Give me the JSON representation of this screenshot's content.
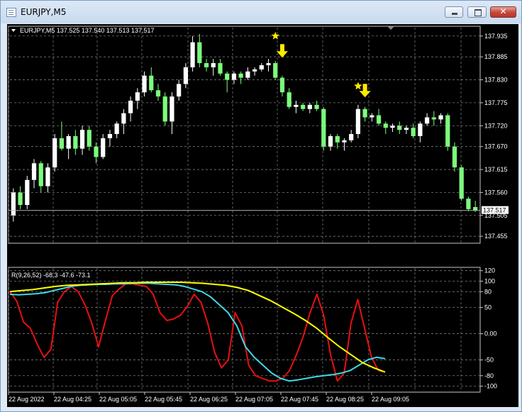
{
  "window": {
    "title": "EURJPY,M5"
  },
  "price_panel": {
    "header": "EURJPY,M5  137.525 137.540 137.513 137.517",
    "current_price_label": "137.517",
    "price_ticks": [
      "137.935",
      "137.885",
      "137.830",
      "137.775",
      "137.720",
      "137.670",
      "137.615",
      "137.560",
      "137.505",
      "137.455"
    ],
    "colors": {
      "bull": "#ffffff",
      "bear": "#7cfc7c",
      "markers": "#ffea00"
    }
  },
  "indicator_panel": {
    "header": "R(9,26,52) -68.3 -47.6 -73.1",
    "ticks": [
      "120",
      "100",
      "80",
      "50",
      "0.00",
      "-50",
      "-80",
      "-100"
    ],
    "colors": {
      "fast": "#e81010",
      "medium": "#3fd9e8",
      "slow": "#ffff00"
    }
  },
  "time_axis": [
    "22 Aug 2022",
    "22 Aug 04:25",
    "22 Aug 05:05",
    "22 Aug 05:45",
    "22 Aug 06:25",
    "22 Aug 07:05",
    "22 Aug 07:45",
    "22 Aug 08:25",
    "22 Aug 09:05"
  ],
  "chart_data": {
    "type": "candlestick",
    "symbol": "EURJPY",
    "timeframe": "M5",
    "last_bar": {
      "open": 137.525,
      "high": 137.54,
      "low": 137.513,
      "close": 137.517
    },
    "ylim": [
      137.44,
      137.955
    ],
    "candles": [
      [
        137.505,
        137.57,
        137.49,
        137.56
      ],
      [
        137.56,
        137.575,
        137.52,
        137.53
      ],
      [
        137.53,
        137.6,
        137.52,
        137.59
      ],
      [
        137.59,
        137.64,
        137.57,
        137.63
      ],
      [
        137.63,
        137.635,
        137.56,
        137.575
      ],
      [
        137.575,
        137.63,
        137.56,
        137.62
      ],
      [
        137.62,
        137.7,
        137.61,
        137.69
      ],
      [
        137.69,
        137.73,
        137.66,
        137.665
      ],
      [
        137.665,
        137.7,
        137.64,
        137.695
      ],
      [
        137.695,
        137.71,
        137.65,
        137.665
      ],
      [
        137.665,
        137.72,
        137.65,
        137.71
      ],
      [
        137.71,
        137.72,
        137.66,
        137.67
      ],
      [
        137.67,
        137.68,
        137.63,
        137.645
      ],
      [
        137.645,
        137.7,
        137.64,
        137.69
      ],
      [
        137.69,
        137.71,
        137.67,
        137.7
      ],
      [
        137.7,
        137.73,
        137.69,
        137.725
      ],
      [
        137.725,
        137.76,
        137.7,
        137.75
      ],
      [
        137.75,
        137.79,
        137.73,
        137.78
      ],
      [
        137.78,
        137.81,
        137.76,
        137.8
      ],
      [
        137.8,
        137.85,
        137.79,
        137.84
      ],
      [
        137.84,
        137.86,
        137.8,
        137.805
      ],
      [
        137.805,
        137.82,
        137.78,
        137.79
      ],
      [
        137.79,
        137.8,
        137.72,
        137.73
      ],
      [
        137.73,
        137.8,
        137.7,
        137.79
      ],
      [
        137.79,
        137.83,
        137.78,
        137.82
      ],
      [
        137.82,
        137.87,
        137.81,
        137.86
      ],
      [
        137.86,
        137.935,
        137.85,
        137.92
      ],
      [
        137.92,
        137.94,
        137.86,
        137.87
      ],
      [
        137.87,
        137.88,
        137.85,
        137.86
      ],
      [
        137.86,
        137.88,
        137.84,
        137.87
      ],
      [
        137.87,
        137.88,
        137.84,
        137.845
      ],
      [
        137.845,
        137.85,
        137.8,
        137.83
      ],
      [
        137.83,
        137.85,
        137.82,
        137.845
      ],
      [
        137.845,
        137.85,
        137.82,
        137.835
      ],
      [
        137.835,
        137.86,
        137.83,
        137.85
      ],
      [
        137.85,
        137.86,
        137.84,
        137.855
      ],
      [
        137.855,
        137.87,
        137.85,
        137.865
      ],
      [
        137.865,
        137.88,
        137.85,
        137.87
      ],
      [
        137.87,
        137.875,
        137.83,
        137.835
      ],
      [
        137.835,
        137.84,
        137.79,
        137.8
      ],
      [
        137.8,
        137.81,
        137.76,
        137.765
      ],
      [
        137.765,
        137.78,
        137.75,
        137.77
      ],
      [
        137.77,
        137.775,
        137.755,
        137.76
      ],
      [
        137.76,
        137.775,
        137.75,
        137.77
      ],
      [
        137.77,
        137.78,
        137.755,
        137.76
      ],
      [
        137.76,
        137.765,
        137.66,
        137.67
      ],
      [
        137.67,
        137.7,
        137.66,
        137.695
      ],
      [
        137.695,
        137.7,
        137.665,
        137.68
      ],
      [
        137.68,
        137.69,
        137.66,
        137.685
      ],
      [
        137.685,
        137.71,
        137.68,
        137.7
      ],
      [
        137.7,
        137.77,
        137.69,
        137.76
      ],
      [
        137.76,
        137.765,
        137.73,
        137.74
      ],
      [
        137.74,
        137.75,
        137.73,
        137.745
      ],
      [
        137.745,
        137.76,
        137.72,
        137.725
      ],
      [
        137.725,
        137.73,
        137.7,
        137.715
      ],
      [
        137.715,
        137.725,
        137.705,
        137.72
      ],
      [
        137.72,
        137.73,
        137.7,
        137.71
      ],
      [
        137.71,
        137.72,
        137.7,
        137.715
      ],
      [
        137.715,
        137.725,
        137.69,
        137.695
      ],
      [
        137.695,
        137.73,
        137.68,
        137.725
      ],
      [
        137.725,
        137.75,
        137.72,
        137.74
      ],
      [
        137.74,
        137.755,
        137.72,
        137.735
      ],
      [
        137.735,
        137.75,
        137.725,
        137.745
      ],
      [
        137.745,
        137.75,
        137.66,
        137.67
      ],
      [
        137.67,
        137.68,
        137.61,
        137.62
      ],
      [
        137.62,
        137.625,
        137.54,
        137.545
      ],
      [
        137.545,
        137.55,
        137.515,
        137.52
      ],
      [
        137.525,
        137.54,
        137.513,
        137.517
      ]
    ],
    "annotations": [
      {
        "type": "star",
        "bar": 38,
        "price": 137.935
      },
      {
        "type": "arrow-down",
        "bar": 39,
        "price": 137.895
      },
      {
        "type": "star",
        "bar": 50,
        "price": 137.815
      },
      {
        "type": "arrow-down",
        "bar": 51,
        "price": 137.8
      }
    ],
    "indicator": {
      "ylim": [
        -110,
        125
      ],
      "series": [
        {
          "values": [
            80,
            62,
            22,
            10,
            -20,
            -45,
            -30,
            60,
            80,
            90,
            80,
            55,
            20,
            -25,
            25,
            72,
            85,
            95,
            95,
            92,
            90,
            75,
            40,
            25,
            28,
            35,
            52,
            75,
            60,
            20,
            -35,
            -65,
            -50,
            40,
            15,
            -60,
            -80,
            -85,
            -90,
            -90,
            -85,
            -70,
            -40,
            -5,
            40,
            75,
            35,
            -40,
            -90,
            -75,
            20,
            65,
            10,
            -45,
            -70,
            -73.1
          ]
        },
        {
          "values": [
            75,
            74,
            75,
            76,
            78,
            82,
            86,
            90,
            92,
            93,
            94,
            94,
            95,
            95,
            96,
            96,
            96,
            95,
            94,
            93,
            90,
            85,
            80,
            70,
            55,
            40,
            15,
            -25,
            -45,
            -60,
            -75,
            -85,
            -90,
            -88,
            -85,
            -82,
            -80,
            -78,
            -75,
            -70,
            -60,
            -50,
            -45,
            -47.6
          ]
        },
        {
          "values": [
            80,
            82,
            84,
            87,
            90,
            92,
            93,
            94,
            95,
            96,
            97,
            97,
            98,
            98,
            98,
            98,
            97,
            96,
            94,
            92,
            88,
            82,
            72,
            62,
            50,
            38,
            25,
            10,
            -8,
            -25,
            -40,
            -55,
            -65,
            -73.1
          ]
        }
      ]
    }
  }
}
